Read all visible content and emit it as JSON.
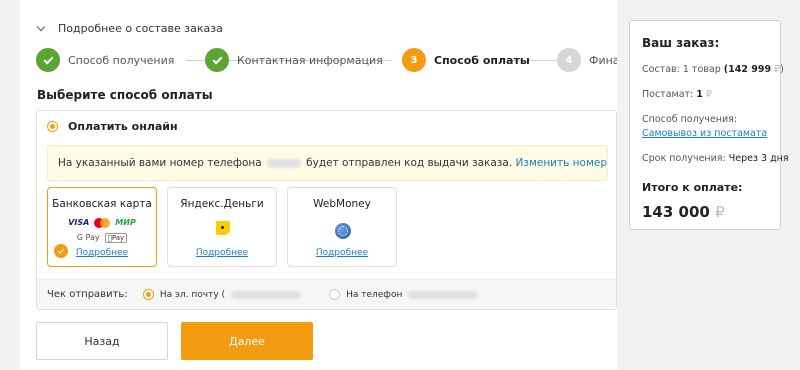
{
  "order_details_toggle": "Подробнее о составе заказа",
  "steps": [
    {
      "number": "",
      "label": "Способ получения",
      "state": "done"
    },
    {
      "number": "",
      "label": "Контактная информация",
      "state": "done"
    },
    {
      "number": "3",
      "label": "Способ оплаты",
      "state": "current"
    },
    {
      "number": "4",
      "label": "Финал",
      "state": "todo"
    }
  ],
  "section_title": "Выберите способ оплаты",
  "online": {
    "label": "Оплатить онлайн",
    "notice_prefix": "На указанный вами номер телефона",
    "notice_suffix": "будет отправлен код выдачи заказа.",
    "notice_link": "Изменить номер"
  },
  "methods": [
    {
      "title": "Банковская карта",
      "more": "Подробнее",
      "selected": true,
      "logos": [
        "VISA",
        "МИР",
        "G Pay",
        "Pay"
      ]
    },
    {
      "title": "Яндекс.Деньги",
      "more": "Подробнее",
      "selected": false
    },
    {
      "title": "WebMoney",
      "more": "Подробнее",
      "selected": false
    }
  ],
  "receipt": {
    "label": "Чек отправить:",
    "email_label": "На эл. почту (",
    "phone_label": "На телефон"
  },
  "buttons": {
    "back": "Назад",
    "next": "Далее"
  },
  "summary": {
    "title": "Ваш заказ:",
    "composition_label": "Состав:",
    "composition_value": "1 товар",
    "composition_price": "(142 999",
    "postamat_label": "Постамат:",
    "postamat_value": "1",
    "receive_method_label": "Способ получения:",
    "receive_method_value": "Самовывоз из постамата",
    "period_label": "Срок получения:",
    "period_value": "Через 3 дня",
    "total_label": "Итого к оплате:",
    "total_value": "143 000",
    "currency": "₽",
    "composition_close": ")"
  },
  "colors": {
    "accent": "#f39c12",
    "done": "#5aa531",
    "link": "#1b7fc3"
  }
}
